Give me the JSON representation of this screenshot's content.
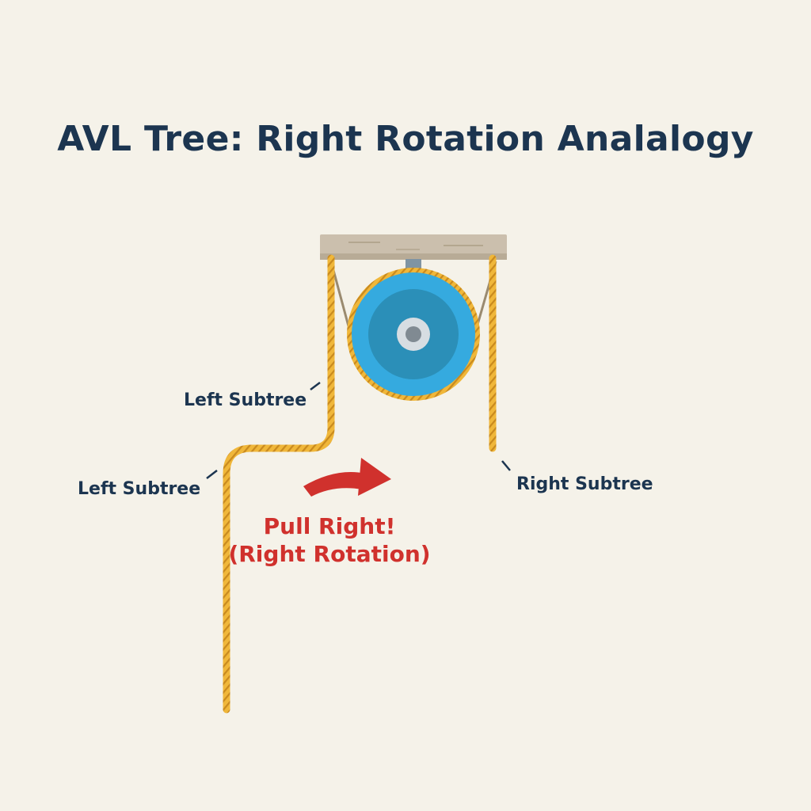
{
  "title": "AVL Tree: Right Rotation Analalogy",
  "labels": {
    "left_subtree_upper": "Left Subtree",
    "left_subtree_lower": "Left Subtree",
    "right_subtree": "Right Subtree",
    "pull_line1": "Pull Right!",
    "pull_line2": "(Right Rotation)"
  },
  "colors": {
    "background": "#f5f2e9",
    "title": "#1c3550",
    "rope": "#f0b73a",
    "rope_twist": "#c98a1e",
    "wheel_outer": "#35aadf",
    "wheel_inner": "#2b8fb8",
    "beam": "#cbbfad",
    "arrow": "#d0312d"
  },
  "icons": {
    "pulley": "pulley-wheel-icon",
    "arrow": "curved-arrow-right-icon"
  }
}
